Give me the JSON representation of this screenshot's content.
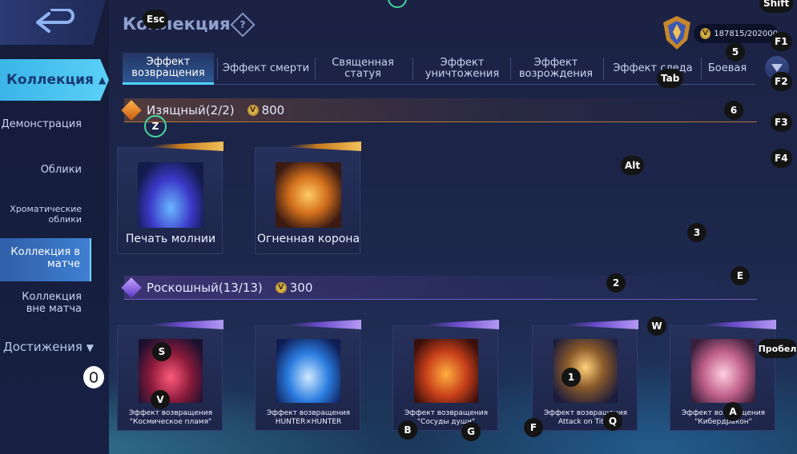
{
  "header": {
    "title": "Коллекция",
    "help_icon": "?",
    "points": "187815/202000"
  },
  "sidebar": {
    "main_label": "Коллекция",
    "items": [
      {
        "label": "Демонстрация"
      },
      {
        "label": "Облики"
      },
      {
        "label": "Хроматические облики"
      },
      {
        "label": "Коллекция в матче"
      },
      {
        "label": "Коллекция вне матча"
      }
    ],
    "achievements_label": "Достижения"
  },
  "tabs": [
    {
      "label": "Эффект возвращения"
    },
    {
      "label": "Эффект смерти"
    },
    {
      "label": "Священная статуя"
    },
    {
      "label": "Эффект уничтожения"
    },
    {
      "label": "Эффект возрождения"
    },
    {
      "label": "Эффект следа"
    },
    {
      "label": "Боевая"
    }
  ],
  "sections": [
    {
      "title": "Изящный(2/2)",
      "price": "800",
      "items": [
        {
          "name": "Печать молнии"
        },
        {
          "name": "Огненная корона"
        }
      ]
    },
    {
      "title": "Роскошный(13/13)",
      "price": "300",
      "items": [
        {
          "name": "Эффект возвращения \"Космическое пламя\""
        },
        {
          "name": "Эффект возвращения HUNTER×HUNTER"
        },
        {
          "name": "Эффект возвращения \"Сосуды души\""
        },
        {
          "name": "Эффект возвращения Attack on Titan"
        },
        {
          "name": "Эффект возвращения \"Кибердракон\""
        }
      ]
    }
  ],
  "key_hints": {
    "esc": "Esc",
    "shift": "Shift",
    "f1": "F1",
    "f2": "F2",
    "f3": "F3",
    "f4": "F4",
    "tab": "Tab",
    "alt": "Alt",
    "space": "Пробел",
    "k1": "1",
    "k2": "2",
    "k3": "3",
    "k5": "5",
    "k6": "6",
    "z": "Z",
    "e": "E",
    "w": "W",
    "s": "S",
    "v": "V",
    "b": "B",
    "g": "G",
    "f": "F",
    "q": "Q",
    "a": "A"
  },
  "colors": {
    "accent_cyan": "#4fd3ff",
    "gold": "#d68a2a",
    "purple": "#7a5bd6"
  }
}
